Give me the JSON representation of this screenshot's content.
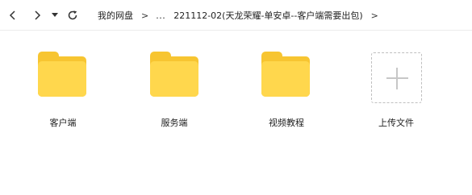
{
  "toolbar": {
    "back_icon": "chevron-left-icon",
    "forward_icon": "chevron-right-icon",
    "history_icon": "caret-down-icon",
    "refresh_icon": "refresh-icon"
  },
  "breadcrumb": {
    "root": "我的网盘",
    "separator": ">",
    "ellipsis": "...",
    "current": "221112-02(天龙荣耀-单安卓--客户端需要出包)"
  },
  "grid": {
    "items": [
      {
        "label": "客户端",
        "type": "folder"
      },
      {
        "label": "服务端",
        "type": "folder"
      },
      {
        "label": "视频教程",
        "type": "folder"
      }
    ],
    "upload": {
      "label": "上传文件",
      "icon": "plus-icon"
    }
  },
  "colors": {
    "folder_front": "#ffd74d",
    "folder_back": "#f7c531",
    "upload_border": "#bfbfbf"
  }
}
